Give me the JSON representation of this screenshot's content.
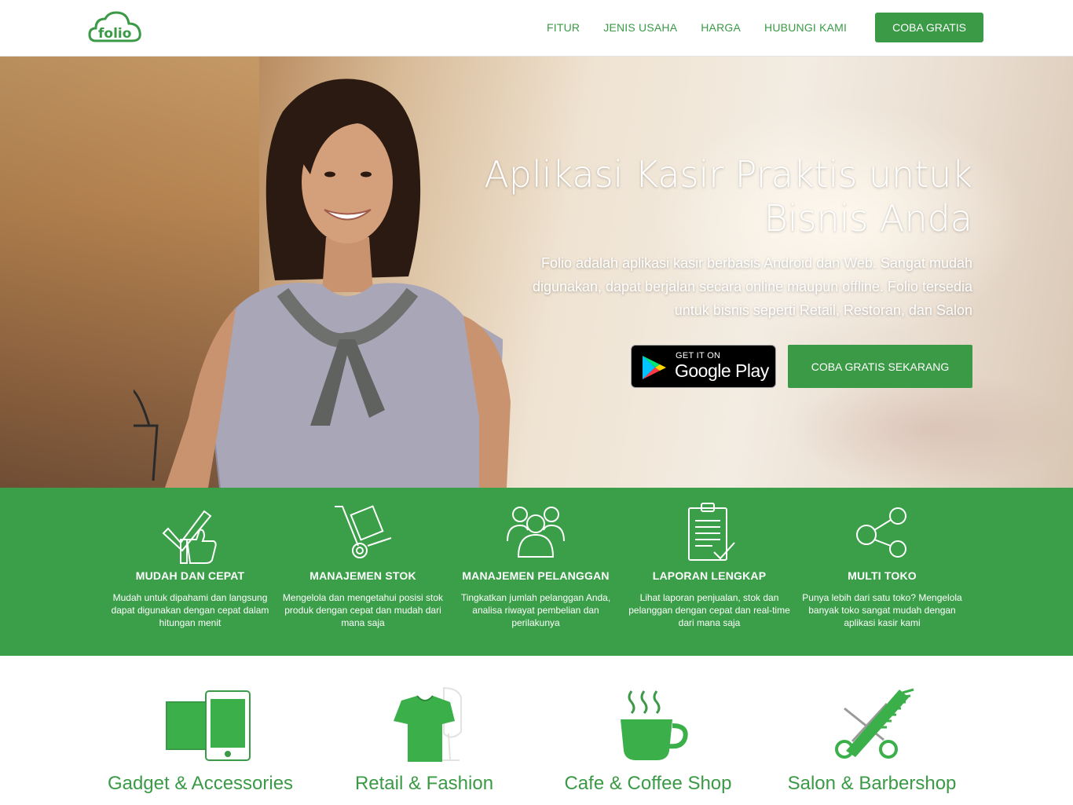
{
  "brand": {
    "logo_text": "folio",
    "color_primary": "#3a9a46"
  },
  "nav": {
    "links": [
      "FITUR",
      "JENIS USAHA",
      "HARGA",
      "HUBUNGI KAMI"
    ],
    "cta": "COBA GRATIS"
  },
  "hero": {
    "title": "Aplikasi Kasir Praktis untuk Bisnis Anda",
    "description": "Folio adalah aplikasi kasir berbasis Android dan Web. Sangat mudah digunakan, dapat berjalan secara online maupun offline. Folio tersedia untuk bisnis seperti Retail, Restoran, dan Salon",
    "google_play": {
      "small": "GET IT ON",
      "big": "Google Play"
    },
    "cta": "COBA GRATIS SEKARANG"
  },
  "features": [
    {
      "icon": "checklist-thumbs-up-icon",
      "title": "MUDAH DAN CEPAT",
      "desc": "Mudah untuk dipahami dan langsung dapat digunakan dengan cepat dalam hitungan menit"
    },
    {
      "icon": "hand-truck-icon",
      "title": "MANAJEMEN STOK",
      "desc": "Mengelola dan mengetahui posisi stok produk dengan cepat dan mudah dari mana saja"
    },
    {
      "icon": "customers-group-icon",
      "title": "MANAJEMEN PELANGGAN",
      "desc": "Tingkatkan jumlah pelanggan Anda, analisa riwayat pembelian dan perilakunya"
    },
    {
      "icon": "clipboard-report-icon",
      "title": "LAPORAN LENGKAP",
      "desc": "Lihat laporan penjualan, stok dan pelanggan dengan cepat dan real-time dari mana saja"
    },
    {
      "icon": "share-network-icon",
      "title": "MULTI TOKO",
      "desc": "Punya lebih dari satu toko? Mengelola banyak toko sangat mudah dengan aplikasi kasir kami"
    }
  ],
  "business_types": [
    {
      "icon": "devices-icon",
      "label": "Gadget & Accessories"
    },
    {
      "icon": "tshirt-mannequin-icon",
      "label": "Retail & Fashion"
    },
    {
      "icon": "coffee-cup-icon",
      "label": "Cafe & Coffee Shop"
    },
    {
      "icon": "scissors-comb-icon",
      "label": "Salon & Barbershop"
    }
  ]
}
